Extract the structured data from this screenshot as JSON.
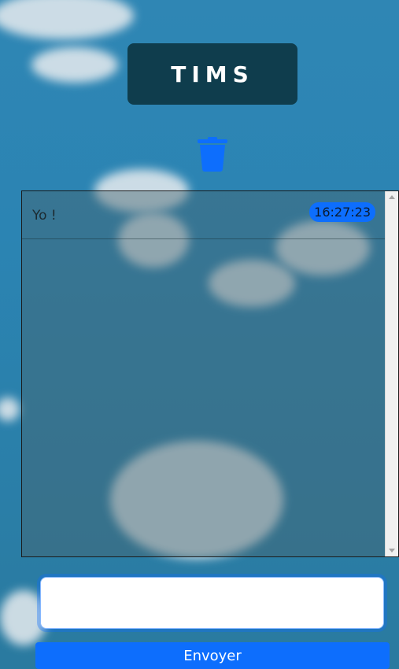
{
  "header": {
    "title": "TIMS"
  },
  "toolbar": {
    "delete_icon": "trash-icon"
  },
  "chat": {
    "messages": [
      {
        "text": "Yo !",
        "time": "16:27:23"
      }
    ]
  },
  "composer": {
    "input_value": "",
    "send_label": "Envoyer"
  },
  "colors": {
    "accent": "#0d6efd",
    "title_bg": "#0f3d4d"
  }
}
